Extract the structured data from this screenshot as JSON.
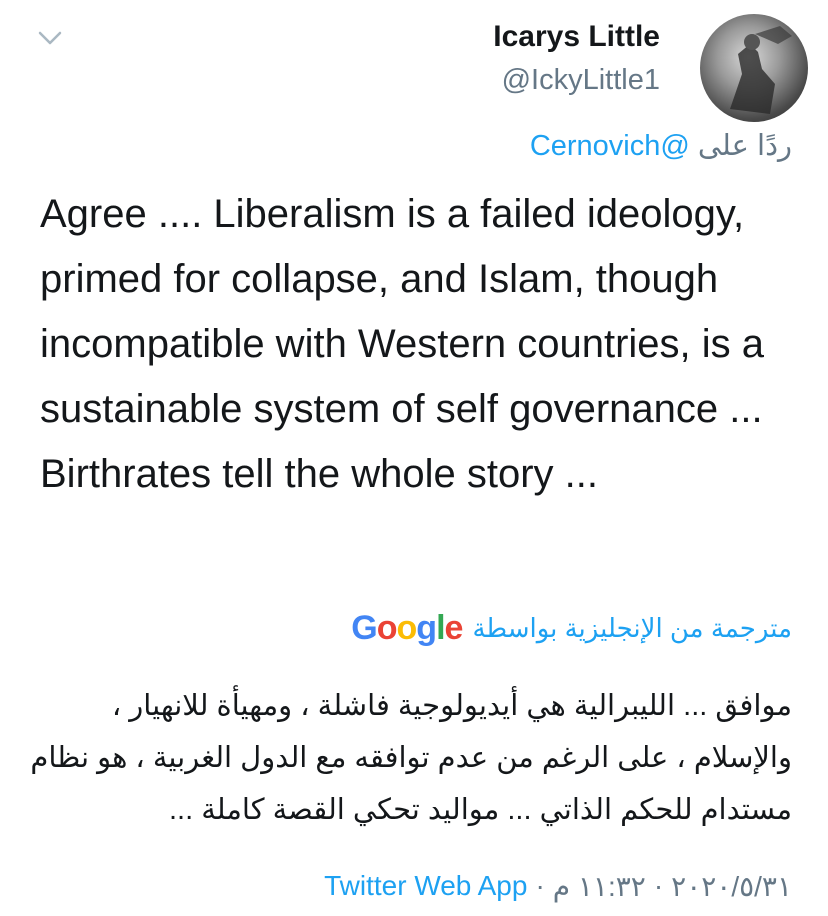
{
  "user": {
    "display_name": "Icarys Little",
    "handle": "@IckyLittle1"
  },
  "reply": {
    "prefix": "ردًا على",
    "mention": "@Cernovich"
  },
  "tweet": {
    "text": "Agree .... Liberalism is a failed ideology, primed for collapse, and Islam, though incompatible with Western countries, is a sustainable system of self governance ... Birthrates tell the whole story ..."
  },
  "translation": {
    "label": "مترجمة من الإنجليزية بواسطة",
    "provider": "Google",
    "text": "موافق ... الليبرالية هي أيديولوجية فاشلة ، ومهيأة للانهيار ، والإسلام ، على الرغم من عدم توافقه مع الدول الغربية ، هو نظام مستدام للحكم الذاتي ... مواليد تحكي القصة كاملة ..."
  },
  "meta": {
    "date": "٢٠٢٠/٥/٣١",
    "time": "١١:٣٢ م",
    "separator": "·",
    "source": "Twitter Web App"
  },
  "icons": {
    "chevron": "chevron-down-icon",
    "avatar": "avatar"
  },
  "colors": {
    "text": "#14171a",
    "secondary": "#657786",
    "link": "#1da1f2"
  }
}
